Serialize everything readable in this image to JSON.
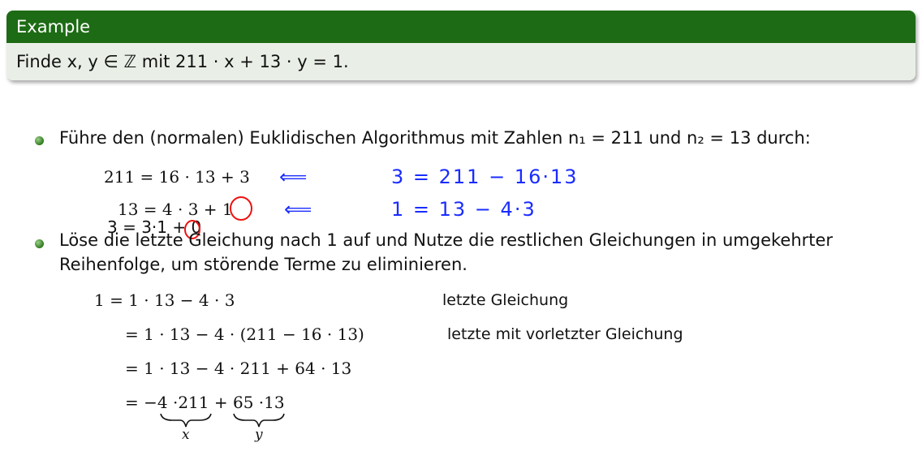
{
  "block": {
    "title": "Example",
    "body": "Finde x, y ∈ ℤ mit 211 · x + 13 · y  =  1."
  },
  "bullets": [
    "Führe den (normalen) Euklidischen Algorithmus mit Zahlen n₁ = 211 und n₂ = 13 durch:",
    "Löse die letzte Gleichung nach 1 auf und Nutze die restlichen Gleichungen in umgekehrter",
    "Reihenfolge, um störende Terme zu eliminieren."
  ],
  "euclid": {
    "eq1": "211 = 16 · 13 + 3",
    "eq2": "13 = 4 · 3 + 1"
  },
  "handwritten": {
    "arrow": "⟸",
    "note1": "3 = 211 − 16·13",
    "note2": "1 = 13 − 4·3",
    "note3": "3 = 3·1 + 0"
  },
  "backsub": {
    "line1": "1 = 1 · 13 − 4 · 3",
    "line2": "= 1 · 13 − 4 · (211 − 16 · 13)",
    "line3": "= 1 · 13 − 4 · 211 + 64 · 13",
    "line4_a": "= ",
    "line4_x": "−4",
    "line4_b": " ·211 + ",
    "line4_y": "65",
    "line4_c": " ·13",
    "brace_x": "x",
    "brace_y": "y",
    "comment1": "letzte Gleichung",
    "comment2": "letzte mit vorletzter Gleichung"
  }
}
